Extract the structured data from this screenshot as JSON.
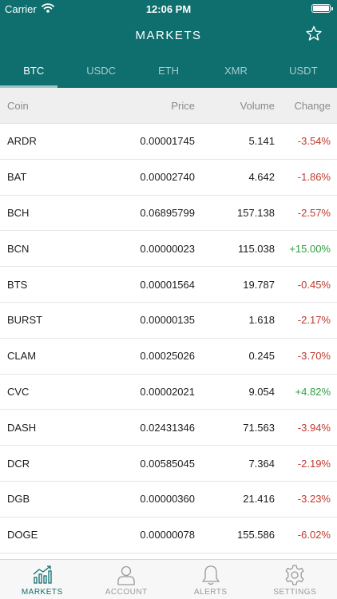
{
  "status_bar": {
    "carrier": "Carrier",
    "time": "12:06 PM"
  },
  "nav": {
    "title": "MARKETS"
  },
  "tabs": [
    {
      "label": "BTC",
      "active": true
    },
    {
      "label": "USDC",
      "active": false
    },
    {
      "label": "ETH",
      "active": false
    },
    {
      "label": "XMR",
      "active": false
    },
    {
      "label": "USDT",
      "active": false
    }
  ],
  "table": {
    "headers": {
      "coin": "Coin",
      "price": "Price",
      "volume": "Volume",
      "change": "Change"
    },
    "rows": [
      {
        "coin": "ARDR",
        "price": "0.00001745",
        "volume": "5.141",
        "change": "-3.54%"
      },
      {
        "coin": "BAT",
        "price": "0.00002740",
        "volume": "4.642",
        "change": "-1.86%"
      },
      {
        "coin": "BCH",
        "price": "0.06895799",
        "volume": "157.138",
        "change": "-2.57%"
      },
      {
        "coin": "BCN",
        "price": "0.00000023",
        "volume": "115.038",
        "change": "+15.00%"
      },
      {
        "coin": "BTS",
        "price": "0.00001564",
        "volume": "19.787",
        "change": "-0.45%"
      },
      {
        "coin": "BURST",
        "price": "0.00000135",
        "volume": "1.618",
        "change": "-2.17%"
      },
      {
        "coin": "CLAM",
        "price": "0.00025026",
        "volume": "0.245",
        "change": "-3.70%"
      },
      {
        "coin": "CVC",
        "price": "0.00002021",
        "volume": "9.054",
        "change": "+4.82%"
      },
      {
        "coin": "DASH",
        "price": "0.02431346",
        "volume": "71.563",
        "change": "-3.94%"
      },
      {
        "coin": "DCR",
        "price": "0.00585045",
        "volume": "7.364",
        "change": "-2.19%"
      },
      {
        "coin": "DGB",
        "price": "0.00000360",
        "volume": "21.416",
        "change": "-3.23%"
      },
      {
        "coin": "DOGE",
        "price": "0.00000078",
        "volume": "155.586",
        "change": "-6.02%"
      }
    ]
  },
  "tabbar": {
    "markets": "MARKETS",
    "account": "ACCOUNT",
    "alerts": "ALERTS",
    "settings": "SETTINGS"
  },
  "colors": {
    "brand": "#0f6e6e",
    "negative": "#c0392b",
    "positive": "#2e9e3e",
    "inactive": "#9a9a9a"
  },
  "icons": [
    "wifi-icon",
    "battery-icon",
    "star-icon",
    "bar-chart-icon",
    "user-icon",
    "bell-icon",
    "gear-icon"
  ]
}
